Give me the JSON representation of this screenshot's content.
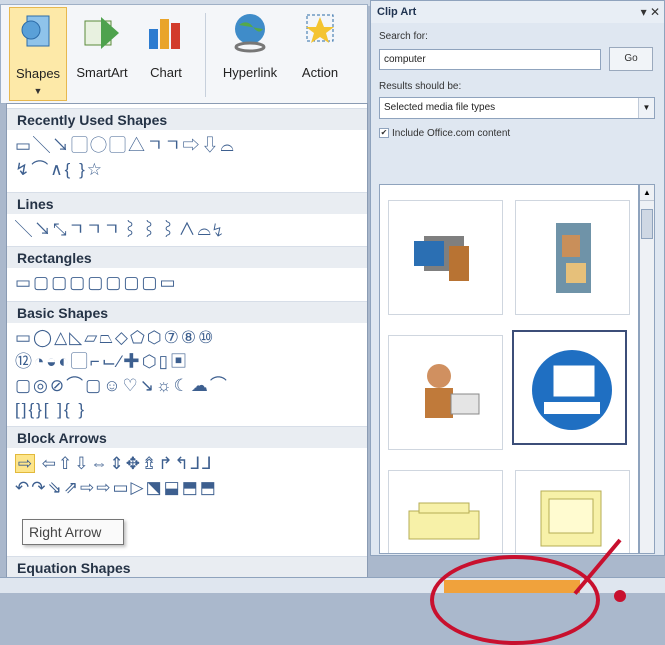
{
  "ribbon": {
    "buttons": {
      "shapes": "Shapes",
      "smartart": "SmartArt",
      "chart": "Chart",
      "hyperlink": "Hyperlink",
      "action": "Action"
    }
  },
  "gallery": {
    "sections": {
      "recent": "Recently Used Shapes",
      "lines": "Lines",
      "rectangles": "Rectangles",
      "basic": "Basic Shapes",
      "block": "Block Arrows",
      "equation": "Equation Shapes"
    },
    "rows": {
      "recent1": "▭╲↘▢◯▢△ㄱㄱ⇨⇩⌓",
      "recent2": "↯⌒∧{ }☆",
      "lines1": "╲↘⤡ㄱㄱㄱ⌇⌇⌇∧⌓↯",
      "rect1": "▭▢▢▢▢▢▢▢▭",
      "basic1": "▭◯△◺▱⏢◇⬠⬡⑦⑧⑩",
      "basic2": "⑫◔◒◐▢⌐⌙⁄✚⬡▯▣",
      "basic3": "▢◎⊘⌒▢☺♡↘☼☾☁⌒",
      "basic4": "[]{}[ ]{ }",
      "arrows1": "⇦⇧⇩⇔⇕✥⇯↱↰⅃⅃",
      "arrows2": "↶↷⇘⇗⇨⇨▭▷⬔⬓⬒⬒",
      "equation1": "✚━✖➗🟰≠"
    },
    "highlighted_icon": "⇨",
    "tooltip": "Right Arrow"
  },
  "clipart": {
    "title": "Clip Art",
    "search_label": "Search for:",
    "search_value": "computer",
    "go": "Go",
    "results_label": "Results should be:",
    "media_types": "Selected media file types",
    "include_label": "Include Office.com content",
    "include_checked": true
  }
}
